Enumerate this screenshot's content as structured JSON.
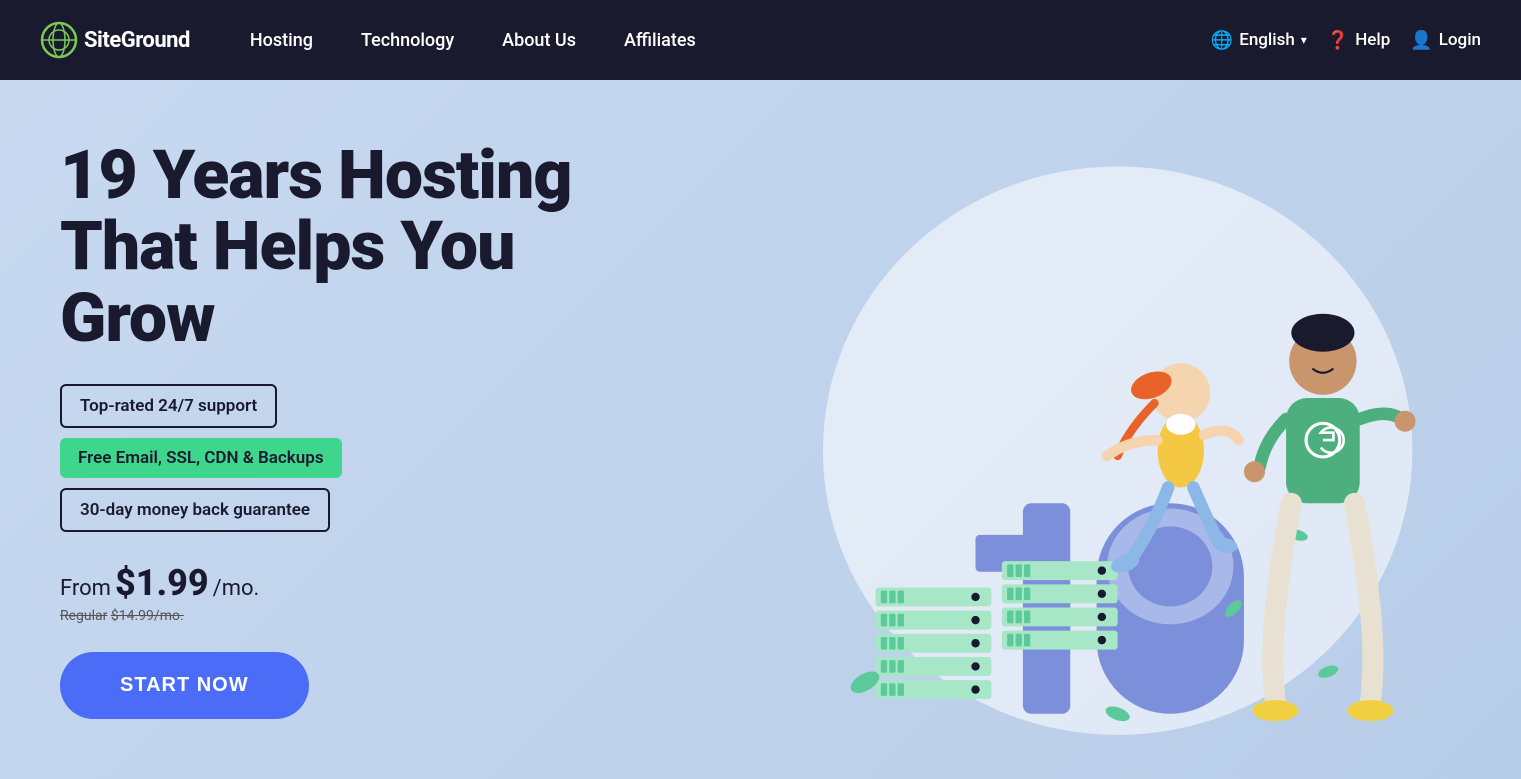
{
  "brand": {
    "name": "SiteGround",
    "logo_alt": "SiteGround Logo"
  },
  "nav": {
    "links": [
      {
        "label": "Hosting",
        "id": "hosting"
      },
      {
        "label": "Technology",
        "id": "technology"
      },
      {
        "label": "About Us",
        "id": "about"
      },
      {
        "label": "Affiliates",
        "id": "affiliates"
      }
    ],
    "right": [
      {
        "label": "English",
        "icon": "translate-icon",
        "has_chevron": true
      },
      {
        "label": "Help",
        "icon": "help-icon"
      },
      {
        "label": "Login",
        "icon": "login-icon"
      }
    ]
  },
  "hero": {
    "title_line1": "19 Years Hosting",
    "title_line2": "That Helps You Grow",
    "badges": [
      {
        "text": "Top-rated 24/7 support",
        "style": "outline"
      },
      {
        "text": "Free Email, SSL, CDN & Backups",
        "style": "green"
      },
      {
        "text": "30-day money back guarantee",
        "style": "outline"
      }
    ],
    "price_from": "From",
    "price_amount": "$1.99",
    "price_per": "/mo.",
    "price_regular_label": "Regular",
    "price_regular_amount": "$14.99/mo.",
    "cta_label": "START NOW"
  }
}
